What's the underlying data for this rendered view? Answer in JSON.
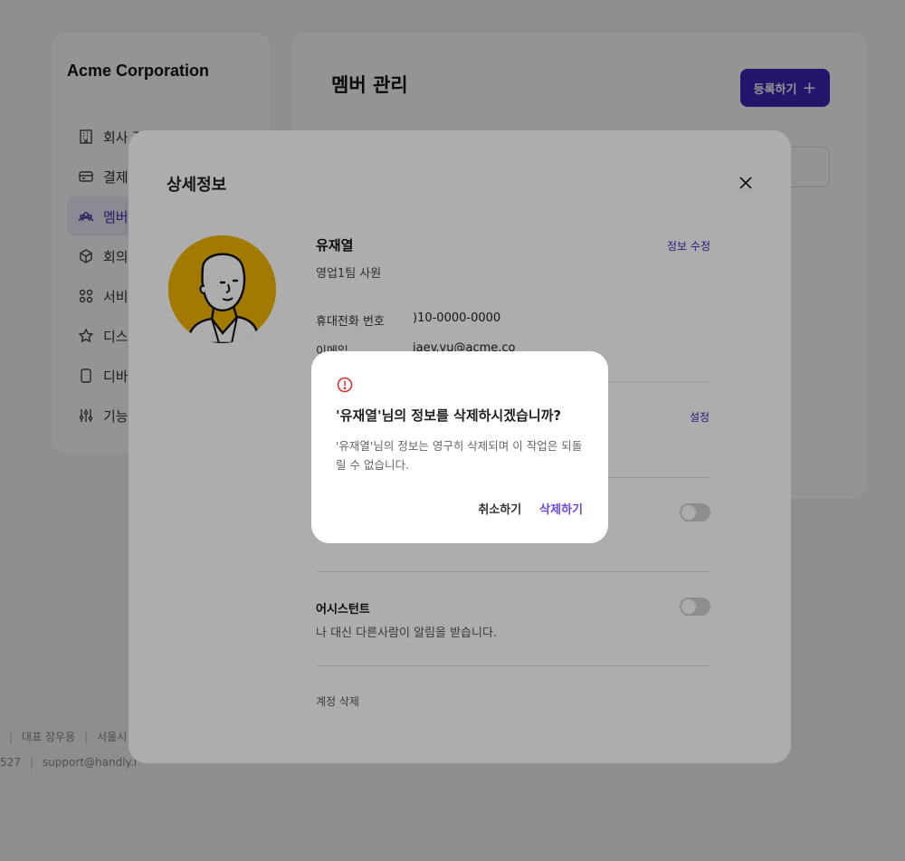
{
  "sidebar": {
    "brand": "Acme Corporation",
    "items": [
      {
        "label": "회사 정보",
        "icon": "building-icon"
      },
      {
        "label": "결제",
        "icon": "credit-card-icon"
      },
      {
        "label": "멤버",
        "icon": "users-icon",
        "active": true
      },
      {
        "label": "회의",
        "icon": "cube-icon"
      },
      {
        "label": "서비",
        "icon": "grid-icon"
      },
      {
        "label": "디스",
        "icon": "star-icon"
      },
      {
        "label": "디바",
        "icon": "device-icon"
      },
      {
        "label": "기능",
        "icon": "sliders-icon"
      }
    ]
  },
  "main": {
    "title": "멤버 관리",
    "register_label": "등록하기"
  },
  "footer": {
    "line1": [
      "대표 장우용",
      "서울시 성"
    ],
    "line2": [
      "527",
      "support@handly.i"
    ]
  },
  "detail": {
    "title": "상세정보",
    "name": "유재열",
    "edit_label": "정보 수정",
    "role": "영업1팀 사원",
    "phone_label": "휴대전화 번호",
    "phone_value": ")10-0000-0000",
    "email_label": "이메일",
    "email_value": "jaey.yu@acme.co",
    "settings_label": "설정",
    "assistant_title": "어시스턴트",
    "assistant_desc": "나 대신 다른사람이 알림을 받습니다.",
    "delete_account_label": "계정 삭제"
  },
  "confirm": {
    "title": "'유재열'님의 정보를 삭제하시겠습니까?",
    "message": "'유재열'님의 정보는 영구히 삭제되며 이 작업은 되돌릴 수 없습니다.",
    "cancel_label": "취소하기",
    "delete_label": "삭제하기"
  },
  "colors": {
    "accent": "#3a27b8",
    "delete_accent": "#6a49e0",
    "avatar_bg": "#f0b400",
    "alert": "#d9342b"
  }
}
